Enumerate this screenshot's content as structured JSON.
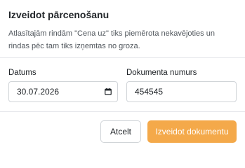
{
  "dialog": {
    "title": "Izveidot pārcenošanu",
    "description": "Atlasītajām rindām \"Cena uz\" tiks piemērota nekavējoties un rindas pēc tam tiks izņemtas no groza."
  },
  "fields": {
    "date": {
      "label": "Datums",
      "value": "30.07.2026",
      "icon": "calendar-icon"
    },
    "document_number": {
      "label": "Dokumenta numurs",
      "value": "454545"
    }
  },
  "buttons": {
    "cancel_label": "Atcelt",
    "primary_label": "Izveidot dokumentu"
  },
  "colors": {
    "primary": "#f4a94a",
    "border": "#d0d4d8",
    "divider": "#e5e7eb"
  }
}
